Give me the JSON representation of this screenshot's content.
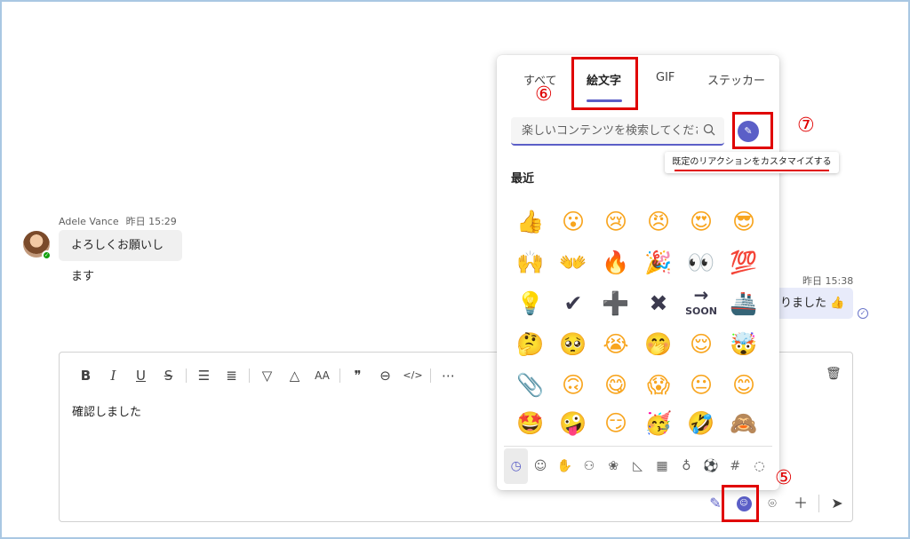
{
  "chat": {
    "left_message": {
      "sender": "Adele Vance",
      "time": "昨日 15:29",
      "text": "よろしくお願いします"
    },
    "right_message": {
      "time": "昨日 15:38",
      "text": "りました"
    }
  },
  "compose": {
    "text": "確認しました",
    "toolbar": [
      "B",
      "I",
      "U",
      "S",
      "list",
      "numbered-list",
      "highlight",
      "font-color",
      "font-size",
      "quote",
      "link",
      "code",
      "more"
    ]
  },
  "emoji_panel": {
    "tabs": {
      "all": "すべて",
      "emoji": "絵文字",
      "gif": "GIF",
      "stickers": "ステッカー",
      "active": "emoji"
    },
    "search_placeholder": "楽しいコンテンツを検索してください",
    "section_title": "最近",
    "tooltip": "既定のリアクションをカスタマイズする",
    "grid": [
      [
        "👍",
        "😮",
        "😢",
        "😠",
        "😍",
        "😎"
      ],
      [
        "🙌",
        "👐",
        "🔥",
        "🎉",
        "👀",
        "💯"
      ],
      [
        "💡",
        "✔",
        "➕",
        "✖",
        "→",
        "🚢"
      ],
      [
        "🤔",
        "🥺",
        "😭",
        "🤭",
        "😌",
        "🤯"
      ],
      [
        "📎",
        "🙃",
        "😋",
        "😱",
        "😐",
        "😊"
      ],
      [
        "🤩",
        "🤪",
        "😏",
        "🥳",
        "🤣",
        "🙈"
      ]
    ],
    "soon_label": "SOON",
    "categories": [
      "recent",
      "smileys",
      "hands",
      "people",
      "animals",
      "food",
      "buildings",
      "objects",
      "activity",
      "symbols",
      "custom"
    ]
  },
  "annotations": {
    "five": "⑤",
    "six": "⑥",
    "seven": "⑦"
  },
  "colors": {
    "accent": "#5b5fc7",
    "annotation": "#e00000"
  }
}
